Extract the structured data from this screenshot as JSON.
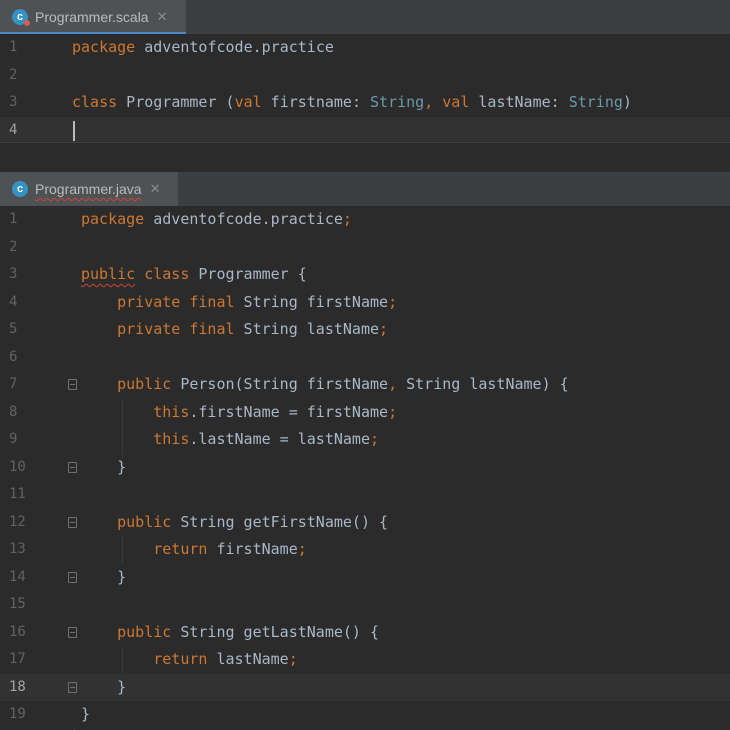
{
  "top_editor": {
    "tab": {
      "label": "Programmer.scala",
      "icon": "scala-class-icon",
      "close": "✕"
    },
    "lines": [
      {
        "n": "1",
        "tokens": [
          {
            "t": "package",
            "c": "kw"
          },
          {
            "t": " adventofcode.practice",
            "c": ""
          }
        ]
      },
      {
        "n": "2",
        "tokens": []
      },
      {
        "n": "3",
        "tokens": [
          {
            "t": "class",
            "c": "kw"
          },
          {
            "t": " Programmer (",
            "c": ""
          },
          {
            "t": "val",
            "c": "kw"
          },
          {
            "t": " firstname: ",
            "c": ""
          },
          {
            "t": "String",
            "c": "ty"
          },
          {
            "t": ", ",
            "c": "kw"
          },
          {
            "t": "val",
            "c": "kw"
          },
          {
            "t": " lastName: ",
            "c": ""
          },
          {
            "t": "String",
            "c": "ty"
          },
          {
            "t": ")",
            "c": ""
          }
        ]
      },
      {
        "n": "4",
        "tokens": []
      }
    ]
  },
  "bottom_editor": {
    "tab": {
      "label": "Programmer.java",
      "icon": "java-class-icon",
      "close": "✕"
    },
    "lines": [
      {
        "n": "1",
        "tokens": [
          {
            "t": "package",
            "c": "kw"
          },
          {
            "t": " adventofcode.practice",
            "c": ""
          },
          {
            "t": ";",
            "c": "kw"
          }
        ]
      },
      {
        "n": "2",
        "tokens": []
      },
      {
        "n": "3",
        "tokens": [
          {
            "t": "public",
            "c": "kw squig"
          },
          {
            "t": " ",
            "c": ""
          },
          {
            "t": "class",
            "c": "kw"
          },
          {
            "t": " Programmer {",
            "c": ""
          }
        ]
      },
      {
        "n": "4",
        "tokens": [
          {
            "t": "    ",
            "c": ""
          },
          {
            "t": "private",
            "c": "kw"
          },
          {
            "t": " ",
            "c": ""
          },
          {
            "t": "final",
            "c": "kw"
          },
          {
            "t": " String firstName",
            "c": ""
          },
          {
            "t": ";",
            "c": "kw"
          }
        ]
      },
      {
        "n": "5",
        "tokens": [
          {
            "t": "    ",
            "c": ""
          },
          {
            "t": "private",
            "c": "kw"
          },
          {
            "t": " ",
            "c": ""
          },
          {
            "t": "final",
            "c": "kw"
          },
          {
            "t": " String lastName",
            "c": ""
          },
          {
            "t": ";",
            "c": "kw"
          }
        ]
      },
      {
        "n": "6",
        "tokens": []
      },
      {
        "n": "7",
        "tokens": [
          {
            "t": "    ",
            "c": ""
          },
          {
            "t": "public",
            "c": "kw"
          },
          {
            "t": " Person(String firstName",
            "c": ""
          },
          {
            "t": ",",
            "c": "kw"
          },
          {
            "t": " String lastName) {",
            "c": ""
          }
        ]
      },
      {
        "n": "8",
        "tokens": [
          {
            "t": "        ",
            "c": ""
          },
          {
            "t": "this",
            "c": "kw"
          },
          {
            "t": ".firstName = firstName",
            "c": ""
          },
          {
            "t": ";",
            "c": "kw"
          }
        ]
      },
      {
        "n": "9",
        "tokens": [
          {
            "t": "        ",
            "c": ""
          },
          {
            "t": "this",
            "c": "kw"
          },
          {
            "t": ".lastName = lastName",
            "c": ""
          },
          {
            "t": ";",
            "c": "kw"
          }
        ]
      },
      {
        "n": "10",
        "tokens": [
          {
            "t": "    }",
            "c": ""
          }
        ]
      },
      {
        "n": "11",
        "tokens": []
      },
      {
        "n": "12",
        "tokens": [
          {
            "t": "    ",
            "c": ""
          },
          {
            "t": "public",
            "c": "kw"
          },
          {
            "t": " String getFirstName() {",
            "c": ""
          }
        ]
      },
      {
        "n": "13",
        "tokens": [
          {
            "t": "        ",
            "c": ""
          },
          {
            "t": "return",
            "c": "kw"
          },
          {
            "t": " firstName",
            "c": ""
          },
          {
            "t": ";",
            "c": "kw"
          }
        ]
      },
      {
        "n": "14",
        "tokens": [
          {
            "t": "    }",
            "c": ""
          }
        ]
      },
      {
        "n": "15",
        "tokens": []
      },
      {
        "n": "16",
        "tokens": [
          {
            "t": "    ",
            "c": ""
          },
          {
            "t": "public",
            "c": "kw"
          },
          {
            "t": " String getLastName() {",
            "c": ""
          }
        ]
      },
      {
        "n": "17",
        "tokens": [
          {
            "t": "        ",
            "c": ""
          },
          {
            "t": "return",
            "c": "kw"
          },
          {
            "t": " lastName",
            "c": ""
          },
          {
            "t": ";",
            "c": "kw"
          }
        ]
      },
      {
        "n": "18",
        "tokens": [
          {
            "t": "    }",
            "c": ""
          }
        ]
      },
      {
        "n": "19",
        "tokens": [
          {
            "t": "}",
            "c": ""
          }
        ]
      }
    ]
  },
  "colors": {
    "background": "#2b2b2b",
    "keyword": "#cc7832",
    "type": "#6a9aa8",
    "text": "#a9b7c6",
    "line_number": "#606366",
    "tab_accent": "#4a88c7"
  }
}
